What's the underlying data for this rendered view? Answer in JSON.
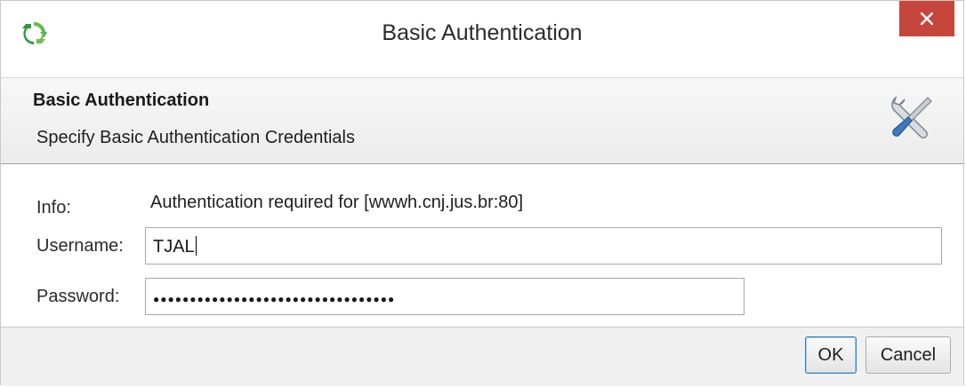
{
  "window": {
    "title": "Basic Authentication",
    "app_icon": "green-arrows-icon",
    "close_icon": "close-icon",
    "colors": {
      "close_button": "#c7463b",
      "header_band": "#f1f1f1",
      "default_button_border": "#3c7fb1"
    }
  },
  "header": {
    "title": "Basic Authentication",
    "subtitle": "Specify Basic Authentication Credentials",
    "icon": "tools-icon"
  },
  "form": {
    "info_label": "Info:",
    "info_text": "Authentication required for [wwwh.cnj.jus.br:80]",
    "username_label": "Username:",
    "username_value": "TJAL",
    "password_label": "Password:",
    "password_value": "●●●●●●●●●●●●●●●●●●●●●●●●●●●●●●●●●"
  },
  "buttons": {
    "ok": "OK",
    "cancel": "Cancel"
  }
}
